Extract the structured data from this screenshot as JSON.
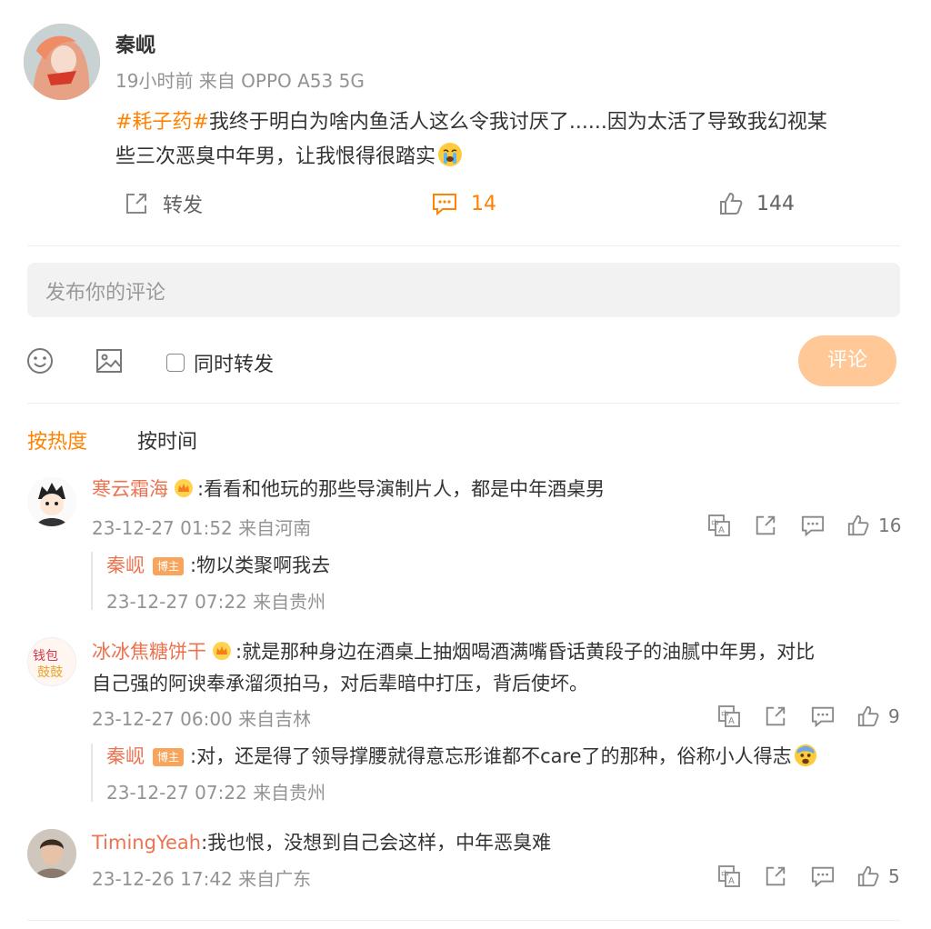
{
  "post": {
    "author": "秦岘",
    "meta": "19小时前 来自 OPPO A53 5G",
    "hashtag": "#耗子药#",
    "text_line1": "我终于明白为啥内鱼活人这么令我讨厌了......因为太活了导致我幻视某",
    "text_line2": "些三次恶臭中年男，让我恨得很踏实",
    "actions": {
      "repost_label": "转发",
      "comment_count": "14",
      "like_count": "144"
    }
  },
  "composer": {
    "placeholder": "发布你的评论",
    "repost_check_label": "同时转发",
    "submit_label": "评论"
  },
  "sort_tabs": {
    "hot": "按热度",
    "time": "按时间"
  },
  "comments": [
    {
      "user": "寒云霜海",
      "text": ":看看和他玩的那些导演制片人，都是中年酒桌男",
      "meta": "23-12-27 01:52 来自河南",
      "likes": "16",
      "reply": {
        "user": "秦岘",
        "badge": "博主",
        "text": ":物以类聚啊我去",
        "meta": "23-12-27 07:22 来自贵州"
      }
    },
    {
      "user": "冰冰焦糖饼干",
      "text_line1": ":就是那种身边在酒桌上抽烟喝酒满嘴昏话黄段子的油腻中年男，对比",
      "text_line2": "自己强的阿谀奉承溜须拍马，对后辈暗中打压，背后使坏。",
      "meta": "23-12-27 06:00 来自吉林",
      "likes": "9",
      "avatar_text": "钱包鼓鼓",
      "reply": {
        "user": "秦岘",
        "badge": "博主",
        "text": ":对，还是得了领导撑腰就得意忘形谁都不care了的那种，俗称小人得志",
        "meta": "23-12-27 07:22 来自贵州"
      }
    },
    {
      "user": "TimingYeah",
      "text": ":我也恨，没想到自己会这样，中年恶臭难",
      "meta": "23-12-26 17:42 来自广东",
      "likes": "5"
    }
  ],
  "colors": {
    "accent": "#ff8200",
    "link_name": "#eb7350",
    "submit_bg": "#ffc896",
    "gray_text": "#939393"
  }
}
